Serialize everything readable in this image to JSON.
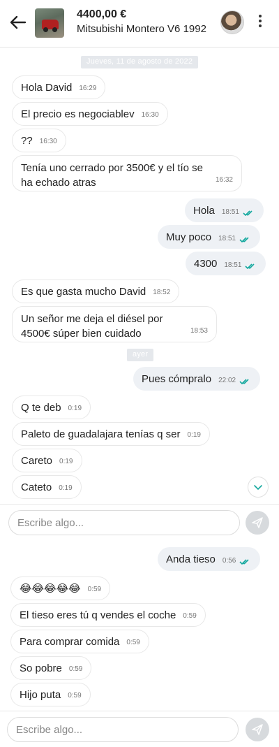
{
  "header": {
    "price": "4400,00 €",
    "title": "Mitsubishi Montero V6 1992"
  },
  "chat": {
    "date_1": "Jueves, 11 de agosto de 2022",
    "date_2": "ayer",
    "messages_1": [
      {
        "text": "Hola David",
        "time": "16:29",
        "dir": "in"
      },
      {
        "text": "El precio es negociablev",
        "time": "16:30",
        "dir": "in"
      },
      {
        "text": "??",
        "time": "16:30",
        "dir": "in"
      },
      {
        "text": "Tenía uno cerrado por 3500€ y el tío se ha echado atras",
        "time": "16:32",
        "dir": "in"
      },
      {
        "text": "Hola",
        "time": "18:51",
        "dir": "out"
      },
      {
        "text": "Muy poco",
        "time": "18:51",
        "dir": "out"
      },
      {
        "text": "4300",
        "time": "18:51",
        "dir": "out"
      },
      {
        "text": "Es que gasta mucho David",
        "time": "18:52",
        "dir": "in"
      },
      {
        "text": "Un señor me deja el diésel por 4500€ súper bien cuidado",
        "time": "18:53",
        "dir": "in"
      }
    ],
    "messages_2": [
      {
        "text": "Pues cómpralo",
        "time": "22:02",
        "dir": "out"
      },
      {
        "text": "Q te deb",
        "time": "0:19",
        "dir": "in"
      },
      {
        "text": "Paleto de guadalajara tenías q ser",
        "time": "0:19",
        "dir": "in"
      },
      {
        "text": "Careto",
        "time": "0:19",
        "dir": "in"
      },
      {
        "text": "Cateto",
        "time": "0:19",
        "dir": "in"
      }
    ],
    "messages_3": [
      {
        "text": "Anda tieso",
        "time": "0:56",
        "dir": "out"
      },
      {
        "text": "😂😂😂😂😂",
        "time": "0:59",
        "dir": "in"
      },
      {
        "text": "El tieso eres tú q vendes el coche",
        "time": "0:59",
        "dir": "in"
      },
      {
        "text": "Para comprar comida",
        "time": "0:59",
        "dir": "in"
      },
      {
        "text": "So pobre",
        "time": "0:59",
        "dir": "in"
      },
      {
        "text": "Hijo puta",
        "time": "0:59",
        "dir": "in"
      }
    ]
  },
  "composer": {
    "placeholder": "Escribe algo..."
  },
  "icons": {
    "back": "arrow-left-icon",
    "more": "kebab-menu-icon",
    "read": "double-check-icon",
    "send": "send-icon",
    "scroll": "chevron-down-icon"
  },
  "colors": {
    "read_ticks": "#13a89e",
    "outgoing_bubble": "#eef1f5",
    "date_chip": "#e5e8ec"
  }
}
